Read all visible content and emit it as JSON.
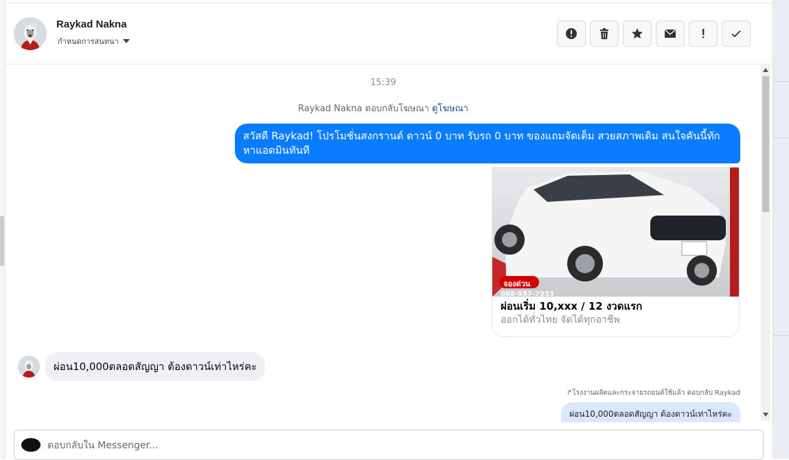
{
  "header": {
    "contact_name": "Raykad Nakna",
    "assign_label": "กำหนดการสนทนา",
    "toolbar": [
      {
        "name": "spam-button",
        "icon": "alert-circle-icon"
      },
      {
        "name": "delete-button",
        "icon": "trash-icon"
      },
      {
        "name": "star-button",
        "icon": "star-icon"
      },
      {
        "name": "mark-unread-button",
        "icon": "envelope-icon"
      },
      {
        "name": "follow-up-button",
        "icon": "exclamation-icon"
      },
      {
        "name": "done-button",
        "icon": "check-icon"
      }
    ]
  },
  "chat": {
    "timestamp": "15:39",
    "ad_reply_text": "Raykad Nakna ตอบกลับโฆษณา",
    "ad_reply_link": "ดูโฆษณา",
    "outgoing_message": "สวัสดี Raykad! โปรโมชั่นสงกรานต์ ดาวน์ 0 บาท รับรถ 0 บาท ของแถมจัดเต็ม สวยสภาพเดิม สนใจคันนี้ทักหาแอดมินทันที",
    "card": {
      "badge": "จองด่วน",
      "phone": "088-557-7933",
      "title": "ผ่อนเริ่ม 10,xxx / 12 งวดแรก",
      "subtitle": "ออกได้ทั่วไทย จัดได้ทุกอาชีพ"
    },
    "incoming_message": "ผ่อน10,000ตลอดสัญญา ต้องดาวน์เท่าไหร่คะ",
    "reply_note": "↱โรงงานผลิตและกระจายรถยนต์ใช้แล้ว ตอบกลับ Raykad",
    "quoted_message": "ผ่อน10,000ตลอดสัญญา ต้องดาวน์เท่าไหร่คะ"
  },
  "composer": {
    "placeholder": "ตอบกลับใน Messenger..."
  },
  "colors": {
    "outgoing_bubble": "#0a7cff",
    "incoming_bubble": "#eef0f3",
    "quoted_bubble": "#d9e8fd",
    "link": "#1a4fa8"
  }
}
